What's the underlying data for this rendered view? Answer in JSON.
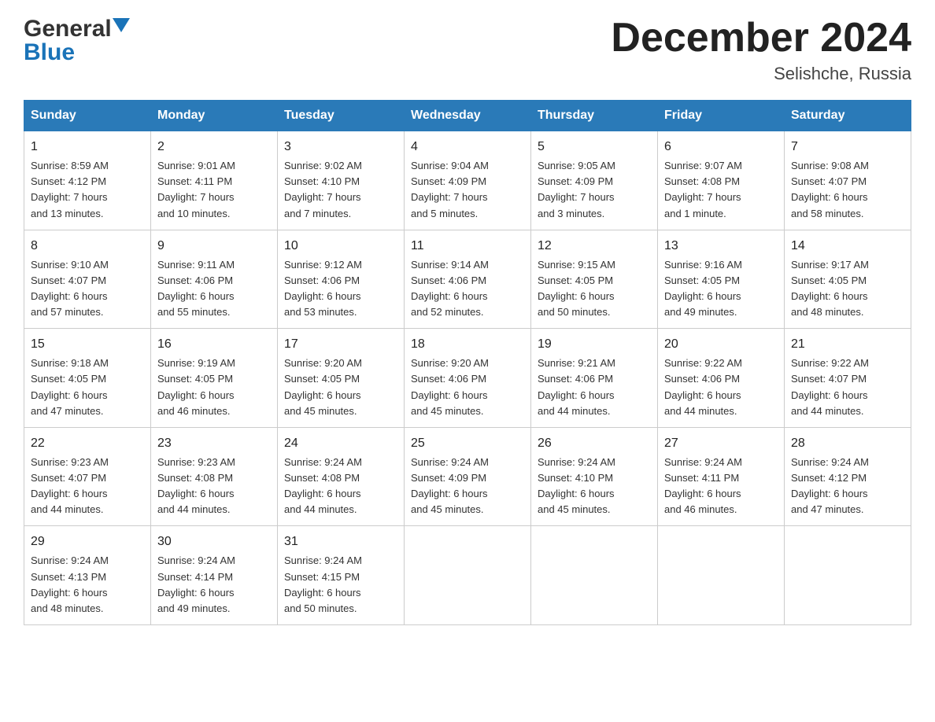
{
  "logo": {
    "general": "General",
    "blue": "Blue"
  },
  "title": "December 2024",
  "location": "Selishche, Russia",
  "days_header": [
    "Sunday",
    "Monday",
    "Tuesday",
    "Wednesday",
    "Thursday",
    "Friday",
    "Saturday"
  ],
  "weeks": [
    [
      {
        "day": "1",
        "sunrise": "8:59 AM",
        "sunset": "4:12 PM",
        "daylight": "7 hours",
        "daylight2": "and 13 minutes."
      },
      {
        "day": "2",
        "sunrise": "9:01 AM",
        "sunset": "4:11 PM",
        "daylight": "7 hours",
        "daylight2": "and 10 minutes."
      },
      {
        "day": "3",
        "sunrise": "9:02 AM",
        "sunset": "4:10 PM",
        "daylight": "7 hours",
        "daylight2": "and 7 minutes."
      },
      {
        "day": "4",
        "sunrise": "9:04 AM",
        "sunset": "4:09 PM",
        "daylight": "7 hours",
        "daylight2": "and 5 minutes."
      },
      {
        "day": "5",
        "sunrise": "9:05 AM",
        "sunset": "4:09 PM",
        "daylight": "7 hours",
        "daylight2": "and 3 minutes."
      },
      {
        "day": "6",
        "sunrise": "9:07 AM",
        "sunset": "4:08 PM",
        "daylight": "7 hours",
        "daylight2": "and 1 minute."
      },
      {
        "day": "7",
        "sunrise": "9:08 AM",
        "sunset": "4:07 PM",
        "daylight": "6 hours",
        "daylight2": "and 58 minutes."
      }
    ],
    [
      {
        "day": "8",
        "sunrise": "9:10 AM",
        "sunset": "4:07 PM",
        "daylight": "6 hours",
        "daylight2": "and 57 minutes."
      },
      {
        "day": "9",
        "sunrise": "9:11 AM",
        "sunset": "4:06 PM",
        "daylight": "6 hours",
        "daylight2": "and 55 minutes."
      },
      {
        "day": "10",
        "sunrise": "9:12 AM",
        "sunset": "4:06 PM",
        "daylight": "6 hours",
        "daylight2": "and 53 minutes."
      },
      {
        "day": "11",
        "sunrise": "9:14 AM",
        "sunset": "4:06 PM",
        "daylight": "6 hours",
        "daylight2": "and 52 minutes."
      },
      {
        "day": "12",
        "sunrise": "9:15 AM",
        "sunset": "4:05 PM",
        "daylight": "6 hours",
        "daylight2": "and 50 minutes."
      },
      {
        "day": "13",
        "sunrise": "9:16 AM",
        "sunset": "4:05 PM",
        "daylight": "6 hours",
        "daylight2": "and 49 minutes."
      },
      {
        "day": "14",
        "sunrise": "9:17 AM",
        "sunset": "4:05 PM",
        "daylight": "6 hours",
        "daylight2": "and 48 minutes."
      }
    ],
    [
      {
        "day": "15",
        "sunrise": "9:18 AM",
        "sunset": "4:05 PM",
        "daylight": "6 hours",
        "daylight2": "and 47 minutes."
      },
      {
        "day": "16",
        "sunrise": "9:19 AM",
        "sunset": "4:05 PM",
        "daylight": "6 hours",
        "daylight2": "and 46 minutes."
      },
      {
        "day": "17",
        "sunrise": "9:20 AM",
        "sunset": "4:05 PM",
        "daylight": "6 hours",
        "daylight2": "and 45 minutes."
      },
      {
        "day": "18",
        "sunrise": "9:20 AM",
        "sunset": "4:06 PM",
        "daylight": "6 hours",
        "daylight2": "and 45 minutes."
      },
      {
        "day": "19",
        "sunrise": "9:21 AM",
        "sunset": "4:06 PM",
        "daylight": "6 hours",
        "daylight2": "and 44 minutes."
      },
      {
        "day": "20",
        "sunrise": "9:22 AM",
        "sunset": "4:06 PM",
        "daylight": "6 hours",
        "daylight2": "and 44 minutes."
      },
      {
        "day": "21",
        "sunrise": "9:22 AM",
        "sunset": "4:07 PM",
        "daylight": "6 hours",
        "daylight2": "and 44 minutes."
      }
    ],
    [
      {
        "day": "22",
        "sunrise": "9:23 AM",
        "sunset": "4:07 PM",
        "daylight": "6 hours",
        "daylight2": "and 44 minutes."
      },
      {
        "day": "23",
        "sunrise": "9:23 AM",
        "sunset": "4:08 PM",
        "daylight": "6 hours",
        "daylight2": "and 44 minutes."
      },
      {
        "day": "24",
        "sunrise": "9:24 AM",
        "sunset": "4:08 PM",
        "daylight": "6 hours",
        "daylight2": "and 44 minutes."
      },
      {
        "day": "25",
        "sunrise": "9:24 AM",
        "sunset": "4:09 PM",
        "daylight": "6 hours",
        "daylight2": "and 45 minutes."
      },
      {
        "day": "26",
        "sunrise": "9:24 AM",
        "sunset": "4:10 PM",
        "daylight": "6 hours",
        "daylight2": "and 45 minutes."
      },
      {
        "day": "27",
        "sunrise": "9:24 AM",
        "sunset": "4:11 PM",
        "daylight": "6 hours",
        "daylight2": "and 46 minutes."
      },
      {
        "day": "28",
        "sunrise": "9:24 AM",
        "sunset": "4:12 PM",
        "daylight": "6 hours",
        "daylight2": "and 47 minutes."
      }
    ],
    [
      {
        "day": "29",
        "sunrise": "9:24 AM",
        "sunset": "4:13 PM",
        "daylight": "6 hours",
        "daylight2": "and 48 minutes."
      },
      {
        "day": "30",
        "sunrise": "9:24 AM",
        "sunset": "4:14 PM",
        "daylight": "6 hours",
        "daylight2": "and 49 minutes."
      },
      {
        "day": "31",
        "sunrise": "9:24 AM",
        "sunset": "4:15 PM",
        "daylight": "6 hours",
        "daylight2": "and 50 minutes."
      },
      null,
      null,
      null,
      null
    ]
  ],
  "labels": {
    "sunrise": "Sunrise: ",
    "sunset": "Sunset: ",
    "daylight": "Daylight: "
  }
}
